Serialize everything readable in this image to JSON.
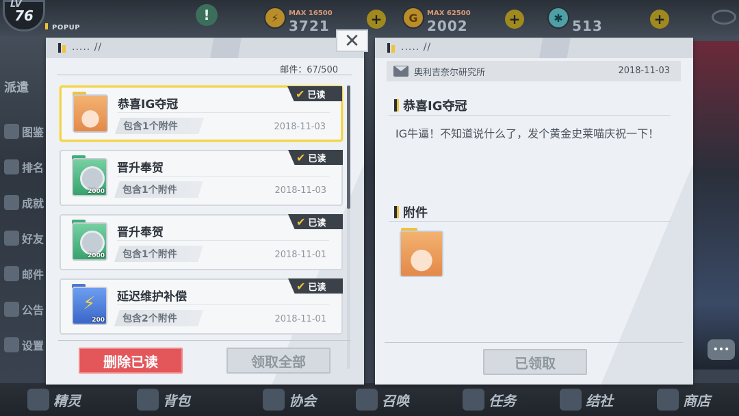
{
  "hud": {
    "level_prefix": "LV",
    "level": "76",
    "alert_icon": "!",
    "resources": [
      {
        "icon": "lightning-icon",
        "icon_glyph": "⚡",
        "max": "MAX 16500",
        "value": "3721",
        "plus": "+"
      },
      {
        "icon": "gold-coin-icon",
        "icon_glyph": "G",
        "max": "MAX 62500",
        "value": "2002",
        "plus": "+"
      },
      {
        "icon": "gear-token-icon",
        "icon_glyph": "✱",
        "max": "",
        "value": "513",
        "plus": "+"
      }
    ],
    "popup_tag": "POPUP"
  },
  "side_menu": {
    "header": "派遣",
    "items": [
      "图鉴",
      "排名",
      "成就",
      "好友",
      "邮件",
      "公告",
      "设置"
    ]
  },
  "bottom_nav": [
    {
      "label": "精灵",
      "icon": "spirit-icon"
    },
    {
      "label": "背包",
      "icon": "bag-icon"
    },
    {
      "label": "协会",
      "icon": "guild-icon"
    },
    {
      "label": "召唤",
      "icon": "summon-icon"
    },
    {
      "label": "任务",
      "icon": "quest-icon"
    },
    {
      "label": "结社",
      "icon": "club-icon"
    },
    {
      "label": "商店",
      "icon": "shop-icon"
    }
  ],
  "left_panel": {
    "header_dots": "..... //",
    "mail_count": "邮件：67/500",
    "mails": [
      {
        "title": "恭喜IG夺冠",
        "attachment": "包含1个附件",
        "date": "2018-11-03",
        "status": "已读",
        "thumb": "girl",
        "qty": ""
      },
      {
        "title": "晋升奉贺",
        "attachment": "包含1个附件",
        "date": "2018-11-03",
        "status": "已读",
        "thumb": "coin",
        "qty": "2000"
      },
      {
        "title": "晋升奉贺",
        "attachment": "包含1个附件",
        "date": "2018-11-01",
        "status": "已读",
        "thumb": "coin",
        "qty": "2000"
      },
      {
        "title": "延迟维护补偿",
        "attachment": "包含2个附件",
        "date": "2018-11-01",
        "status": "已读",
        "thumb": "battery",
        "qty": "200"
      }
    ],
    "delete_read_label": "删除已读",
    "claim_all_label": "领取全部"
  },
  "right_panel": {
    "header_dots": "..... //",
    "sender": "奥利吉奈尔研究所",
    "date": "2018-11-03",
    "title": "恭喜IG夺冠",
    "body": "IG牛逼！不知道说什么了，发个黄金史莱喵庆祝一下！",
    "attachments_label": "附件",
    "claimed_label": "已领取"
  },
  "close_label": "✕",
  "chat_label": "•••",
  "colors": {
    "accent_yellow": "#f2c23a",
    "delete_red": "#e3575b",
    "badge_dark": "#3b4149"
  }
}
